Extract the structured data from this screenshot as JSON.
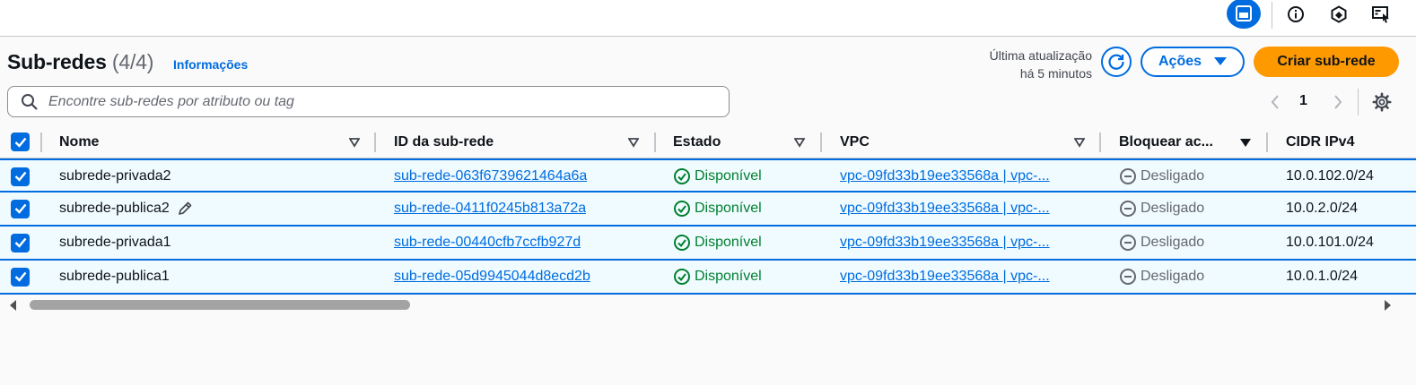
{
  "topbar": {
    "icons": [
      "split-panel-icon",
      "info-icon",
      "settings-hex-icon",
      "screen-icon"
    ]
  },
  "header": {
    "title": "Sub-redes",
    "count": "(4/4)",
    "info_link": "Informações",
    "last_update_line1": "Última atualização",
    "last_update_line2": "há 5 minutos",
    "actions_label": "Ações",
    "create_label": "Criar sub-rede"
  },
  "search": {
    "placeholder": "Encontre sub-redes por atributo ou tag",
    "value": ""
  },
  "pagination": {
    "current_page": "1"
  },
  "table": {
    "columns": [
      "Nome",
      "ID da sub-rede",
      "Estado",
      "VPC",
      "Bloquear ac...",
      "CIDR IPv4"
    ],
    "rows": [
      {
        "name": "subrede-privada2",
        "id": "sub-rede-063f6739621464a6a",
        "state": "Disponível",
        "vpc": "vpc-09fd33b19ee33568a | vpc-...",
        "block": "Desligado",
        "cidr": "10.0.102.0/24",
        "editable": false
      },
      {
        "name": "subrede-publica2",
        "id": "sub-rede-0411f0245b813a72a",
        "state": "Disponível",
        "vpc": "vpc-09fd33b19ee33568a | vpc-...",
        "block": "Desligado",
        "cidr": "10.0.2.0/24",
        "editable": true
      },
      {
        "name": "subrede-privada1",
        "id": "sub-rede-00440cfb7ccfb927d",
        "state": "Disponível",
        "vpc": "vpc-09fd33b19ee33568a | vpc-...",
        "block": "Desligado",
        "cidr": "10.0.101.0/24",
        "editable": false
      },
      {
        "name": "subrede-publica1",
        "id": "sub-rede-05d9945044d8ecd2b",
        "state": "Disponível",
        "vpc": "vpc-09fd33b19ee33568a | vpc-...",
        "block": "Desligado",
        "cidr": "10.0.1.0/24",
        "editable": false
      }
    ]
  },
  "colors": {
    "accent": "#006ce0",
    "primary_button": "#ff9900",
    "success": "#00802f",
    "selected_row": "#f0fbff"
  }
}
